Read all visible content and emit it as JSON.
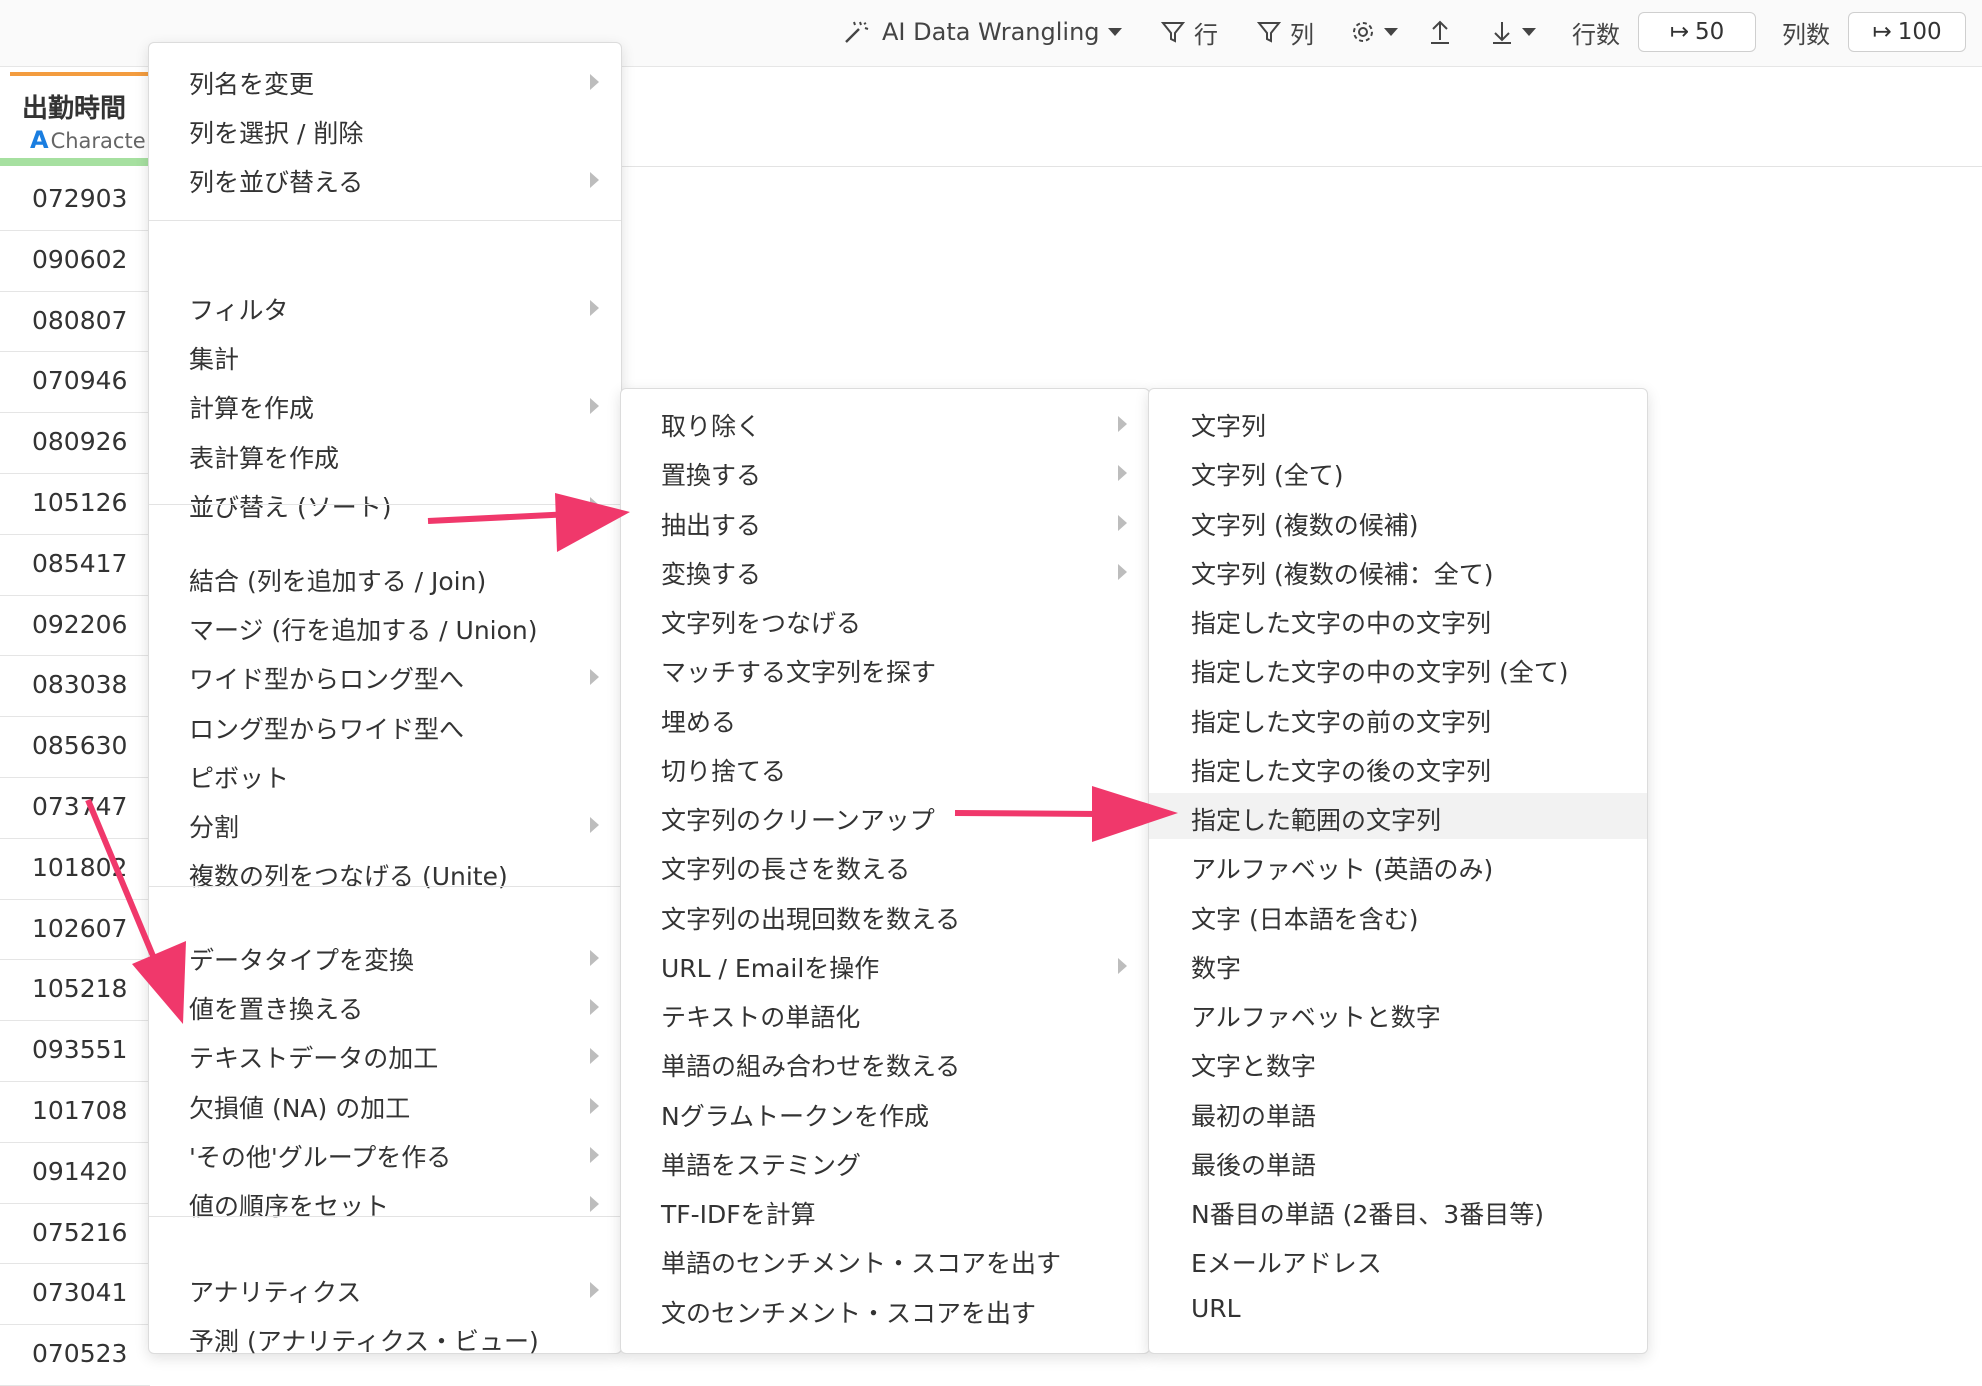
{
  "toolbar": {
    "ai_label": "AI Data Wrangling",
    "row_filter": "行",
    "col_filter": "列",
    "rows_label": "行数",
    "rows_value": "50",
    "cols_label": "列数",
    "cols_value": "100"
  },
  "column": {
    "title": "出勤時間",
    "type_glyph": "A",
    "type": "Characte"
  },
  "rows": [
    "072903",
    "090602",
    "080807",
    "070946",
    "080926",
    "105126",
    "085417",
    "092206",
    "083038",
    "085630",
    "073747",
    "101802",
    "102607",
    "105218",
    "093551",
    "101708",
    "091420",
    "075216",
    "073041",
    "070523"
  ],
  "menu_main": [
    [
      "列名を変更",
      "列を選択 / 削除",
      "列を並び替える"
    ],
    [
      "フィルタ",
      "集計",
      "計算を作成",
      "表計算を作成",
      "並び替え (ソート)"
    ],
    [
      "結合 (列を追加する / Join)",
      "マージ (行を追加する / Union)",
      "ワイド型からロング型へ",
      "ロング型からワイド型へ",
      "ピボット",
      "分割",
      "複数の列をつなげる (Unite)"
    ],
    [
      "データタイプを変換",
      "値を置き換える",
      "テキストデータの加工",
      "欠損値 (NA) の加工",
      "'その他'グループを作る",
      "値の順序をセット"
    ],
    [
      "アナリティクス",
      "予測 (アナリティクス・ビュー)"
    ]
  ],
  "menu_text": [
    "取り除く",
    "置換する",
    "抽出する",
    "変換する",
    "文字列をつなげる",
    "マッチする文字列を探す",
    "埋める",
    "切り捨てる",
    "文字列のクリーンアップ",
    "文字列の長さを数える",
    "文字列の出現回数を数える",
    "URL / Emailを操作",
    "テキストの単語化",
    "単語の組み合わせを数える",
    "Nグラムトークンを作成",
    "単語をステミング",
    "TF-IDFを計算",
    "単語のセンチメント・スコアを出す",
    "文のセンチメント・スコアを出す"
  ],
  "menu_extract": [
    "文字列",
    "文字列 (全て)",
    "文字列 (複数の候補)",
    "文字列 (複数の候補：全て)",
    "指定した文字の中の文字列",
    "指定した文字の中の文字列 (全て)",
    "指定した文字の前の文字列",
    "指定した文字の後の文字列",
    "指定した範囲の文字列",
    "アルファベット (英語のみ)",
    "文字 (日本語を含む)",
    "数字",
    "アルファベットと数字",
    "文字と数字",
    "最初の単語",
    "最後の単語",
    "N番目の単語 (2番目、3番目等)",
    "Eメールアドレス",
    "URL"
  ],
  "colors": {
    "accent_arrow": "#f0386b",
    "header_orange": "#f39c3f",
    "type_blue": "#1a7ee0",
    "header_green": "#a6e0a0"
  }
}
